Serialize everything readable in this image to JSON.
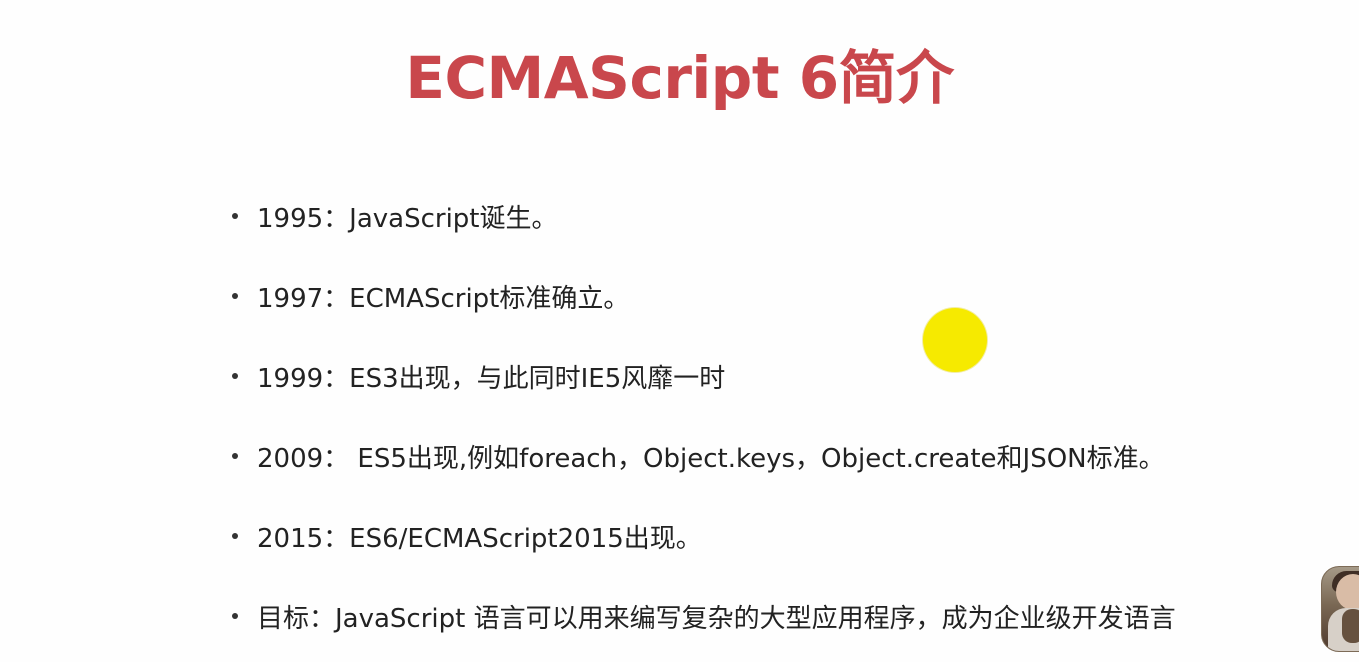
{
  "slide": {
    "title": "ECMAScript 6简介",
    "items": [
      {
        "text": "1995：JavaScript诞生。"
      },
      {
        "text": "1997：ECMAScript标准确立。"
      },
      {
        "text": "1999：ES3出现，与此同时IE5风靡一时"
      },
      {
        "text": "2009： ES5出现,例如foreach，Object.keys，Object.create和JSON标准。"
      },
      {
        "text": "2015：ES6/ECMAScript2015出现。"
      },
      {
        "text": "目标：JavaScript 语言可以用来编写复杂的大型应用程序，成为企业级开发语言"
      }
    ]
  },
  "decorations": {
    "title_color": "#c9474c",
    "pointer_color": "#f6ea00"
  }
}
